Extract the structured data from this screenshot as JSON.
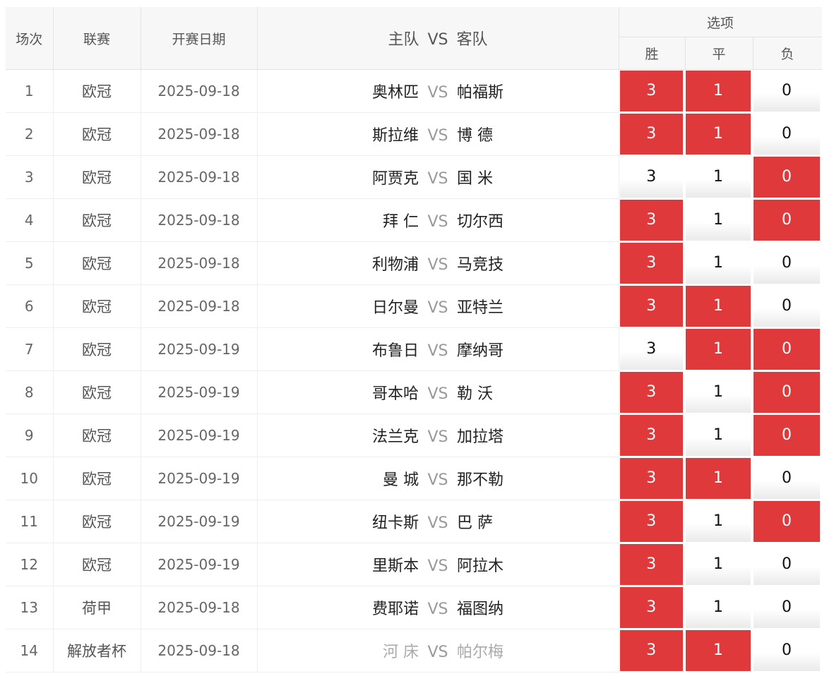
{
  "header": {
    "col_no": "场次",
    "col_league": "联赛",
    "col_date": "开赛日期",
    "col_home": "主队",
    "col_vs": "VS",
    "col_away": "客队",
    "col_options": "选项",
    "opt_win": "胜",
    "opt_draw": "平",
    "opt_lose": "负"
  },
  "colors": {
    "selected": "#e0393b",
    "selected_text": "#ffffff"
  },
  "rows": [
    {
      "no": "1",
      "league": "欧冠",
      "date": "2025-09-18",
      "home": "奥林匹",
      "vs": "VS",
      "away": "帕福斯",
      "w": "3",
      "d": "1",
      "l": "0",
      "sel": [
        true,
        true,
        false
      ]
    },
    {
      "no": "2",
      "league": "欧冠",
      "date": "2025-09-18",
      "home": "斯拉维",
      "vs": "VS",
      "away": "博 德",
      "w": "3",
      "d": "1",
      "l": "0",
      "sel": [
        true,
        true,
        false
      ]
    },
    {
      "no": "3",
      "league": "欧冠",
      "date": "2025-09-18",
      "home": "阿贾克",
      "vs": "VS",
      "away": "国 米",
      "w": "3",
      "d": "1",
      "l": "0",
      "sel": [
        false,
        false,
        true
      ]
    },
    {
      "no": "4",
      "league": "欧冠",
      "date": "2025-09-18",
      "home": "拜 仁",
      "vs": "VS",
      "away": "切尔西",
      "w": "3",
      "d": "1",
      "l": "0",
      "sel": [
        true,
        false,
        true
      ]
    },
    {
      "no": "5",
      "league": "欧冠",
      "date": "2025-09-18",
      "home": "利物浦",
      "vs": "VS",
      "away": "马竞技",
      "w": "3",
      "d": "1",
      "l": "0",
      "sel": [
        true,
        false,
        false
      ]
    },
    {
      "no": "6",
      "league": "欧冠",
      "date": "2025-09-18",
      "home": "日尔曼",
      "vs": "VS",
      "away": "亚特兰",
      "w": "3",
      "d": "1",
      "l": "0",
      "sel": [
        true,
        true,
        false
      ]
    },
    {
      "no": "7",
      "league": "欧冠",
      "date": "2025-09-19",
      "home": "布鲁日",
      "vs": "VS",
      "away": "摩纳哥",
      "w": "3",
      "d": "1",
      "l": "0",
      "sel": [
        false,
        true,
        true
      ]
    },
    {
      "no": "8",
      "league": "欧冠",
      "date": "2025-09-19",
      "home": "哥本哈",
      "vs": "VS",
      "away": "勒 沃",
      "w": "3",
      "d": "1",
      "l": "0",
      "sel": [
        true,
        false,
        true
      ]
    },
    {
      "no": "9",
      "league": "欧冠",
      "date": "2025-09-19",
      "home": "法兰克",
      "vs": "VS",
      "away": "加拉塔",
      "w": "3",
      "d": "1",
      "l": "0",
      "sel": [
        true,
        false,
        true
      ]
    },
    {
      "no": "10",
      "league": "欧冠",
      "date": "2025-09-19",
      "home": "曼 城",
      "vs": "VS",
      "away": "那不勒",
      "w": "3",
      "d": "1",
      "l": "0",
      "sel": [
        true,
        true,
        false
      ]
    },
    {
      "no": "11",
      "league": "欧冠",
      "date": "2025-09-19",
      "home": "纽卡斯",
      "vs": "VS",
      "away": "巴 萨",
      "w": "3",
      "d": "1",
      "l": "0",
      "sel": [
        true,
        false,
        true
      ]
    },
    {
      "no": "12",
      "league": "欧冠",
      "date": "2025-09-19",
      "home": "里斯本",
      "vs": "VS",
      "away": "阿拉木",
      "w": "3",
      "d": "1",
      "l": "0",
      "sel": [
        true,
        false,
        false
      ]
    },
    {
      "no": "13",
      "league": "荷甲",
      "date": "2025-09-18",
      "home": "费耶诺",
      "vs": "VS",
      "away": "福图纳",
      "w": "3",
      "d": "1",
      "l": "0",
      "sel": [
        true,
        false,
        false
      ]
    },
    {
      "no": "14",
      "league": "解放者杯",
      "date": "2025-09-18",
      "home": "河 床",
      "vs": "VS",
      "away": "帕尔梅",
      "w": "3",
      "d": "1",
      "l": "0",
      "sel": [
        true,
        true,
        false
      ],
      "muted": true
    }
  ]
}
